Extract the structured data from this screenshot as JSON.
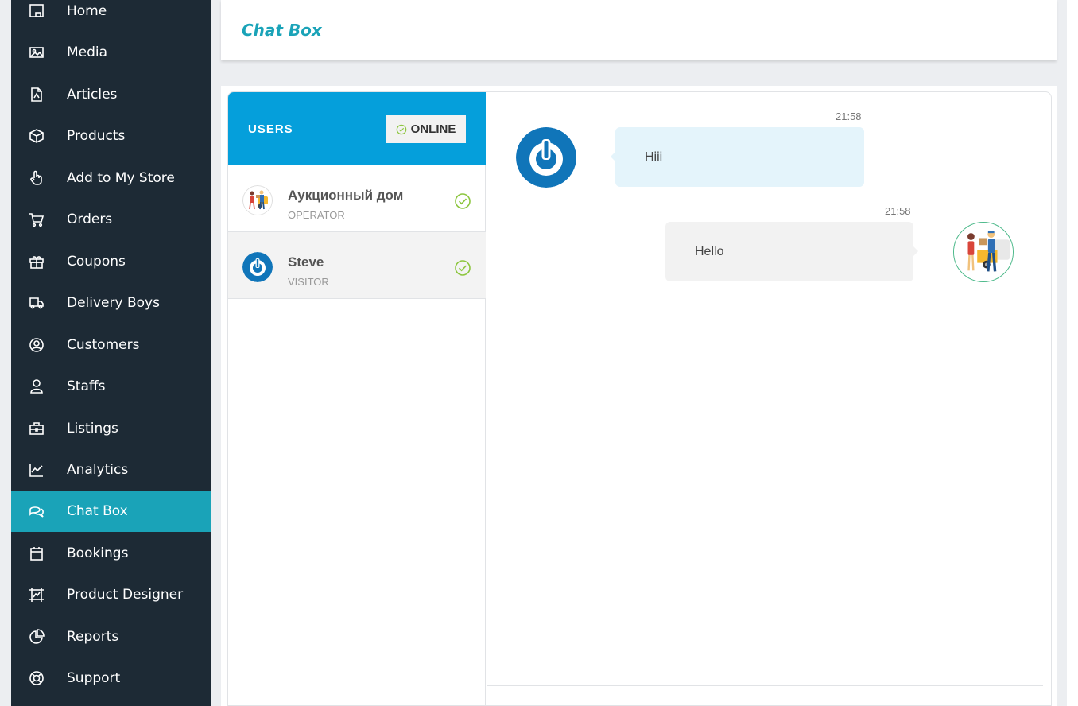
{
  "sidebar": {
    "items": [
      {
        "label": "Home",
        "icon": "home-icon"
      },
      {
        "label": "Media",
        "icon": "image-icon"
      },
      {
        "label": "Articles",
        "icon": "document-icon"
      },
      {
        "label": "Products",
        "icon": "box-icon"
      },
      {
        "label": "Add to My Store",
        "icon": "hand-pointer-icon"
      },
      {
        "label": "Orders",
        "icon": "cart-icon"
      },
      {
        "label": "Coupons",
        "icon": "gift-icon"
      },
      {
        "label": "Delivery Boys",
        "icon": "truck-icon"
      },
      {
        "label": "Customers",
        "icon": "user-circle-icon"
      },
      {
        "label": "Staffs",
        "icon": "user-icon"
      },
      {
        "label": "Listings",
        "icon": "briefcase-icon"
      },
      {
        "label": "Analytics",
        "icon": "chart-line-icon"
      },
      {
        "label": "Chat Box",
        "icon": "chat-icon",
        "active": true
      },
      {
        "label": "Bookings",
        "icon": "calendar-icon"
      },
      {
        "label": "Product Designer",
        "icon": "frame-icon"
      },
      {
        "label": "Reports",
        "icon": "pie-chart-icon"
      },
      {
        "label": "Support",
        "icon": "lifebuoy-icon"
      }
    ],
    "bg_color": "#1d2a35",
    "active_color": "#1aa3b8"
  },
  "page": {
    "title": "Chat Box"
  },
  "users_panel": {
    "title": "USERS",
    "status_label": "ONLINE",
    "header_color": "#059fdb",
    "users": [
      {
        "name": "Аукционный дом",
        "role": "OPERATOR",
        "avatar": "delivery-illustration-avatar",
        "status_icon": "check-circle-icon"
      },
      {
        "name": "Steve",
        "role": "VISITOR",
        "avatar": "power-logo-avatar",
        "status_icon": "check-circle-icon"
      }
    ]
  },
  "messages": [
    {
      "time": "21:58",
      "text": "Hiii",
      "direction": "incoming",
      "avatar": "power-logo-avatar"
    },
    {
      "time": "21:58",
      "text": "Hello",
      "direction": "outgoing",
      "avatar": "delivery-illustration-avatar"
    }
  ]
}
